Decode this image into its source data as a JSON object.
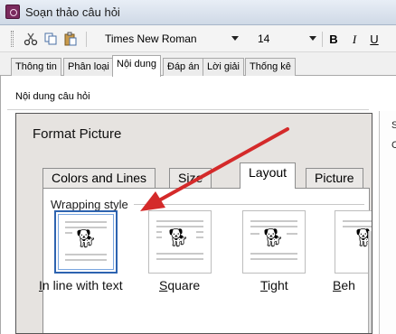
{
  "window": {
    "title": "Soạn thảo câu hỏi",
    "icon": "app-logo-icon"
  },
  "toolbar": {
    "cut_icon": "scissors-icon",
    "copy_icon": "copy-icon",
    "paste_icon": "paste-icon",
    "font_name": "Times New Roman",
    "font_size": "14",
    "bold": "B",
    "italic": "I",
    "underline": "U"
  },
  "tabs": [
    "Thông tin",
    "Phân loại",
    "Nội dung",
    "Đáp án",
    "Lời giải",
    "Thống kê"
  ],
  "active_tab": "Nội dung",
  "content": {
    "section_label": "Nội dung câu hỏi",
    "right_letters": [
      "S",
      "C"
    ],
    "embedded_image": {
      "dialog_title": "Format Picture",
      "tabs": [
        "Colors and Lines",
        "Size",
        "Layout",
        "Picture"
      ],
      "active_tab": "Layout",
      "group_label": "Wrapping style",
      "options": [
        {
          "mnemonic": "I",
          "rest": "n line with text",
          "icon": "inline-with-text-dog-icon"
        },
        {
          "mnemonic": "S",
          "rest": "quare",
          "icon": "square-wrap-dog-icon"
        },
        {
          "mnemonic": "T",
          "rest": "ight",
          "icon": "tight-wrap-dog-icon"
        },
        {
          "mnemonic": "B",
          "rest": "eh",
          "icon": "behind-text-dog-icon"
        }
      ],
      "annotation_color": "#d42a2a"
    }
  },
  "colors": {
    "title_bar": "#d6e0ec",
    "selection": "#2d63b0",
    "panel": "#ffffff"
  }
}
